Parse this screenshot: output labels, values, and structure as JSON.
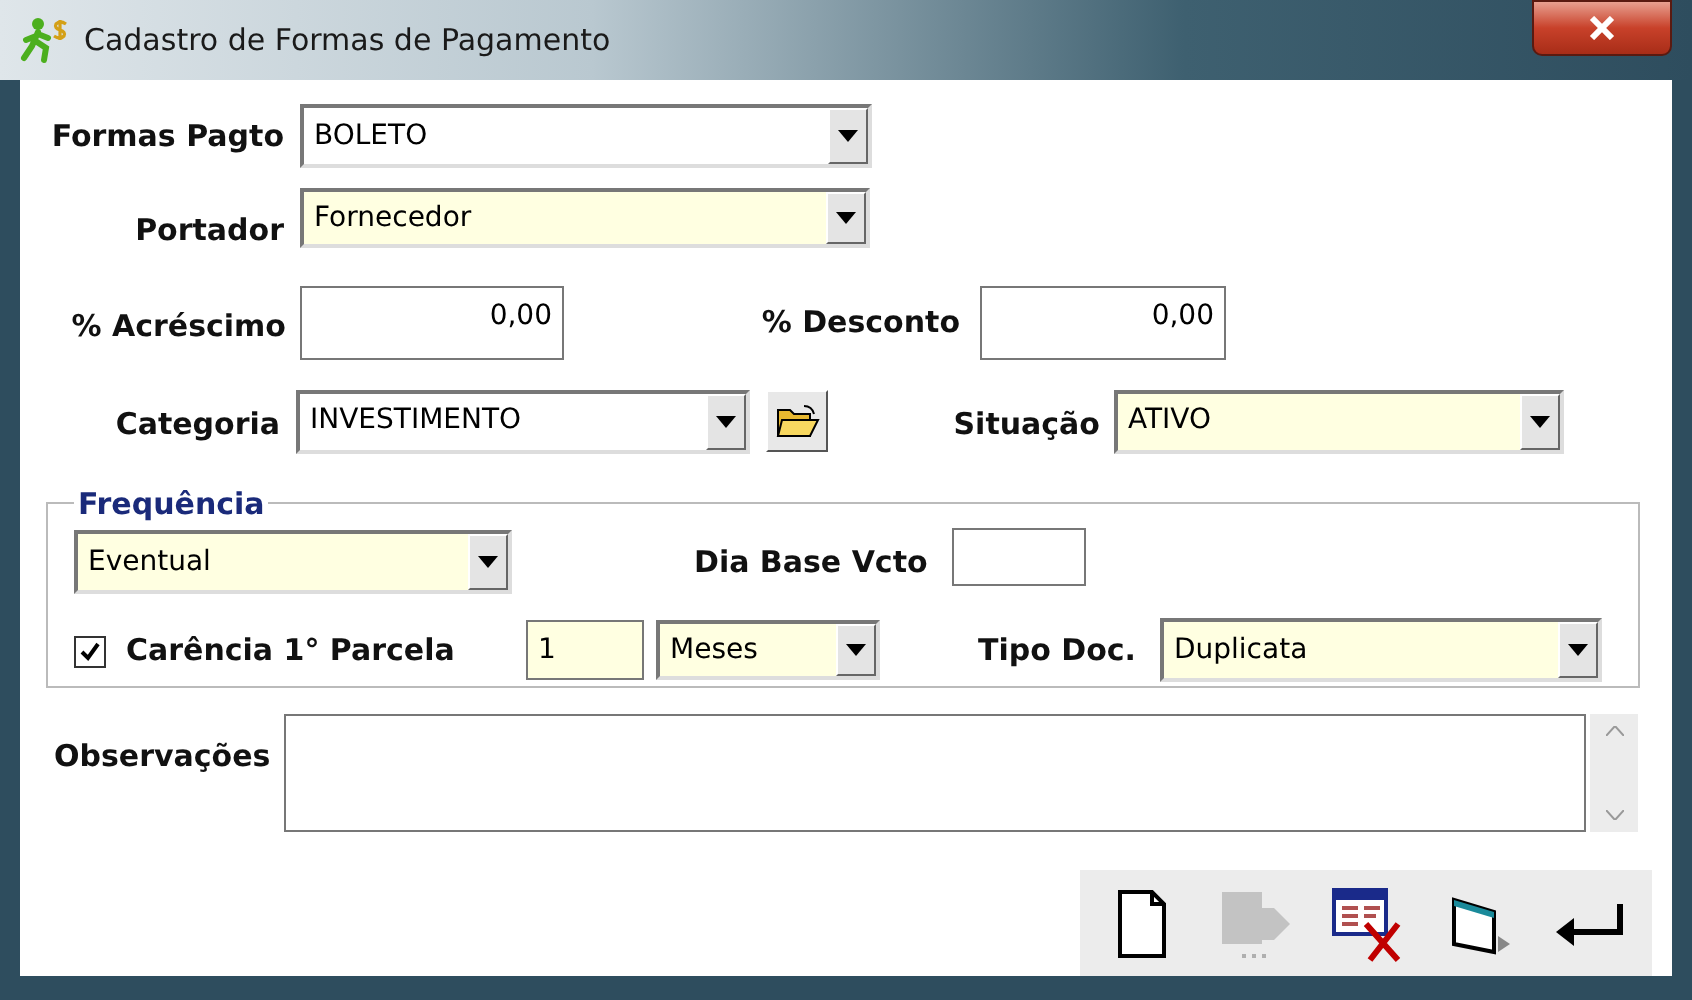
{
  "window": {
    "title": "Cadastro de Formas de Pagamento"
  },
  "formas_pagto": {
    "label": "Formas Pagto",
    "value": "BOLETO",
    "required": false
  },
  "portador": {
    "label": "Portador",
    "value": "Fornecedor",
    "required": true
  },
  "acrescimo": {
    "label": "% Acréscimo",
    "value": "0,00"
  },
  "desconto": {
    "label": "% Desconto",
    "value": "0,00"
  },
  "categoria": {
    "label": "Categoria",
    "value": "INVESTIMENTO",
    "required": false
  },
  "situacao": {
    "label": "Situação",
    "value": "ATIVO",
    "required": true
  },
  "frequencia": {
    "legend": "Frequência",
    "periodicidade": {
      "value": "Eventual",
      "required": true
    },
    "dia_base": {
      "label": "Dia Base Vcto"
    },
    "carencia": {
      "label": "Carência 1° Parcela",
      "checked": true,
      "quantity": "1",
      "unit": "Meses",
      "required": true
    },
    "tipo_doc": {
      "label": "Tipo Doc.",
      "value": "Duplicata",
      "required": true
    }
  },
  "observacoes": {
    "label": "Observações"
  },
  "toolbar": [
    {
      "kind": "new",
      "disabled": false
    },
    {
      "kind": "forward",
      "disabled": true
    },
    {
      "kind": "delete",
      "disabled": false
    },
    {
      "kind": "window",
      "disabled": false
    },
    {
      "kind": "enter",
      "disabled": false
    }
  ]
}
